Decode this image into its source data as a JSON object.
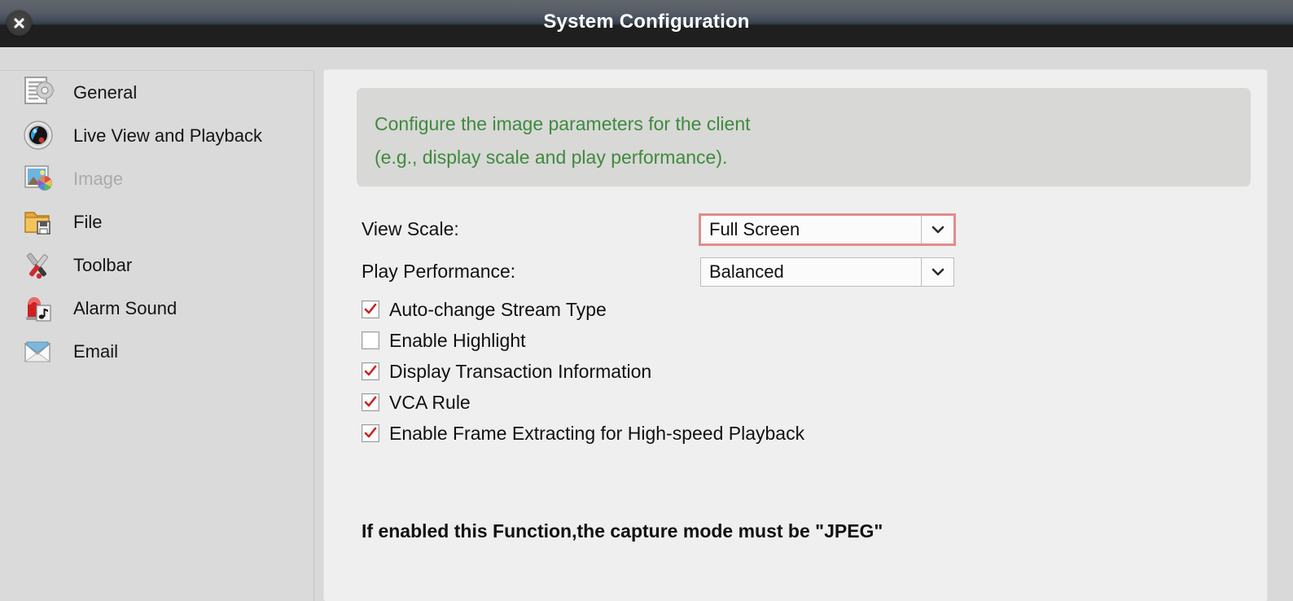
{
  "window": {
    "title": "System Configuration",
    "close_icon": "close-icon"
  },
  "sidebar": {
    "items": [
      {
        "label": "General",
        "icon": "document-gear-icon",
        "disabled": false
      },
      {
        "label": "Live View and Playback",
        "icon": "camera-lens-icon",
        "disabled": false
      },
      {
        "label": "Image",
        "icon": "picture-palette-icon",
        "disabled": true
      },
      {
        "label": "File",
        "icon": "folder-save-icon",
        "disabled": false
      },
      {
        "label": "Toolbar",
        "icon": "hammer-wrench-icon",
        "disabled": false
      },
      {
        "label": "Alarm Sound",
        "icon": "siren-music-icon",
        "disabled": false
      },
      {
        "label": "Email",
        "icon": "envelope-icon",
        "disabled": false
      }
    ]
  },
  "content": {
    "info": {
      "line1": "Configure the image parameters for the client",
      "line2": "(e.g., display scale and play performance)."
    },
    "fields": [
      {
        "label": "View Scale:",
        "value": "Full Screen",
        "focused": true
      },
      {
        "label": "Play Performance:",
        "value": "Balanced",
        "focused": false
      }
    ],
    "checkboxes": [
      {
        "label": "Auto-change Stream Type",
        "checked": true
      },
      {
        "label": "Enable Highlight",
        "checked": false
      },
      {
        "label": "Display Transaction Information",
        "checked": true
      },
      {
        "label": "VCA Rule",
        "checked": true
      },
      {
        "label": "Enable Frame Extracting for High-speed Playback",
        "checked": true
      }
    ],
    "note": "If enabled this Function,the capture mode must be \"JPEG\""
  },
  "colors": {
    "info_text": "#3e8a3e",
    "focus_border": "#e08d8d",
    "check_mark": "#cc2222",
    "titlebar_dark": "#1f1f1f"
  }
}
